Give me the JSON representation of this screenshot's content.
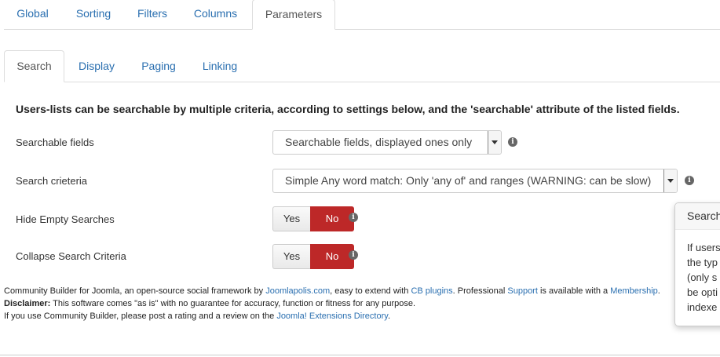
{
  "top_tabs": [
    "Global",
    "Sorting",
    "Filters",
    "Columns",
    "Parameters"
  ],
  "sub_tabs": [
    "Search",
    "Display",
    "Paging",
    "Linking"
  ],
  "intro": "Users-lists can be searchable by multiple criteria, according to settings below, and the 'searchable' attribute of the listed fields.",
  "fields": {
    "searchable_fields": {
      "label": "Searchable fields",
      "value": "Searchable fields, displayed ones only"
    },
    "search_criteria": {
      "label": "Search crieteria",
      "value": "Simple Any word match: Only 'any of' and ranges (WARNING: can be slow)"
    },
    "hide_empty": {
      "label": "Hide Empty Searches",
      "yes": "Yes",
      "no": "No"
    },
    "collapse": {
      "label": "Collapse Search Criteria",
      "yes": "Yes",
      "no": "No"
    }
  },
  "info_glyph": "i",
  "popover": {
    "title": "Search",
    "lines": [
      "If users",
      "the typ",
      "(only s",
      "be opti",
      "indexe"
    ]
  },
  "footer": {
    "l1_a": "Community Builder for Joomla, an open-source social framework by ",
    "l1_link1": "Joomlapolis.com",
    "l1_b": ", easy to extend with ",
    "l1_link2": "CB plugins",
    "l1_c": ". Professional ",
    "l1_link3": "Support",
    "l1_d": " is available with a ",
    "l1_link4": "Membership",
    "l1_e": ".",
    "l2_bold": "Disclaimer:",
    "l2_text": " This software comes \"as is\" with no guarantee for accuracy, function or fitness for any purpose.",
    "l3_a": "If you use Community Builder, please post a rating and a review on the ",
    "l3_link": "Joomla! Extensions Directory",
    "l3_b": "."
  },
  "colors": {
    "link": "#2a6fb0",
    "no_active": "#bd2828"
  }
}
